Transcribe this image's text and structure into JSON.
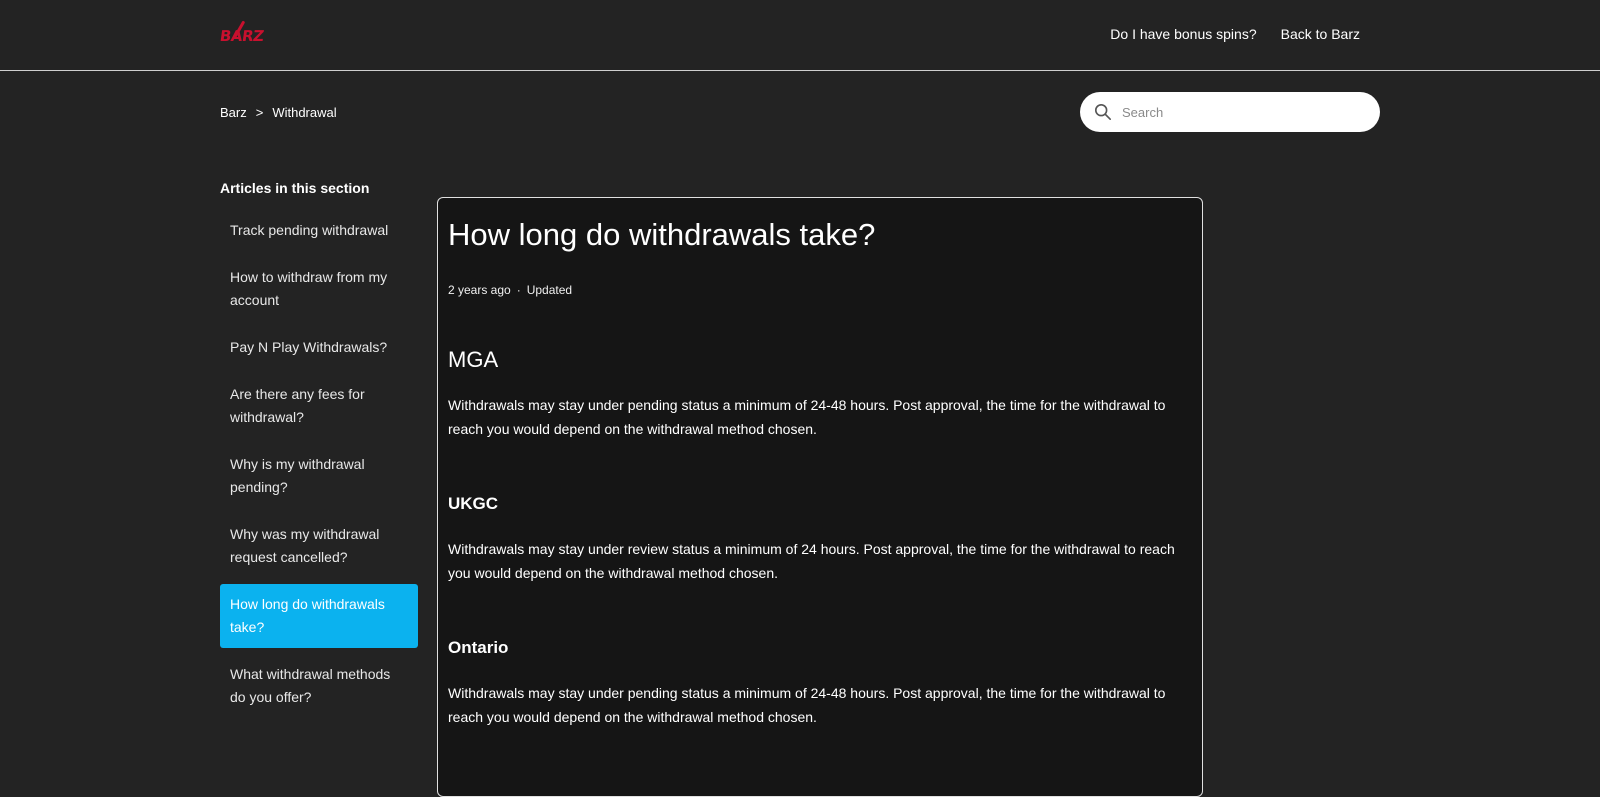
{
  "brand": {
    "logo_text": "BARZ",
    "accent_color": "#0bb2ef",
    "logo_color": "#c8102e"
  },
  "top_nav": {
    "items": [
      {
        "label": "Do I have bonus spins?"
      },
      {
        "label": "Back to Barz"
      }
    ]
  },
  "breadcrumb": {
    "items": [
      "Barz",
      "Withdrawal"
    ],
    "separator": ">"
  },
  "search": {
    "placeholder": "Search",
    "icon": "search-icon"
  },
  "sidebar": {
    "title": "Articles in this section",
    "items": [
      {
        "label": "Track pending withdrawal",
        "active": false
      },
      {
        "label": "How to withdraw from my account",
        "active": false
      },
      {
        "label": "Pay N Play Withdrawals?",
        "active": false
      },
      {
        "label": "Are there any fees for withdrawal?",
        "active": false
      },
      {
        "label": "Why is my withdrawal pending?",
        "active": false
      },
      {
        "label": "Why was my withdrawal request cancelled?",
        "active": false
      },
      {
        "label": "How long do withdrawals take?",
        "active": true
      },
      {
        "label": "What withdrawal methods do you offer?",
        "active": false
      }
    ]
  },
  "article": {
    "title": "How long do withdrawals take?",
    "meta": {
      "time": "2 years ago",
      "separator": "·",
      "status": "Updated"
    },
    "sections": [
      {
        "heading": "MGA",
        "body": "Withdrawals may stay under pending status a minimum of 24-48 hours. Post approval, the time for the withdrawal to reach you would depend on the withdrawal method chosen."
      },
      {
        "heading": "UKGC",
        "body": "Withdrawals may stay under review status a minimum of 24 hours. Post approval, the time for the withdrawal to reach you would depend on the withdrawal method chosen."
      },
      {
        "heading": "Ontario",
        "body": "Withdrawals may stay under pending status a minimum of 24-48 hours. Post approval, the time for the withdrawal to reach you would depend on the withdrawal method chosen."
      }
    ]
  }
}
